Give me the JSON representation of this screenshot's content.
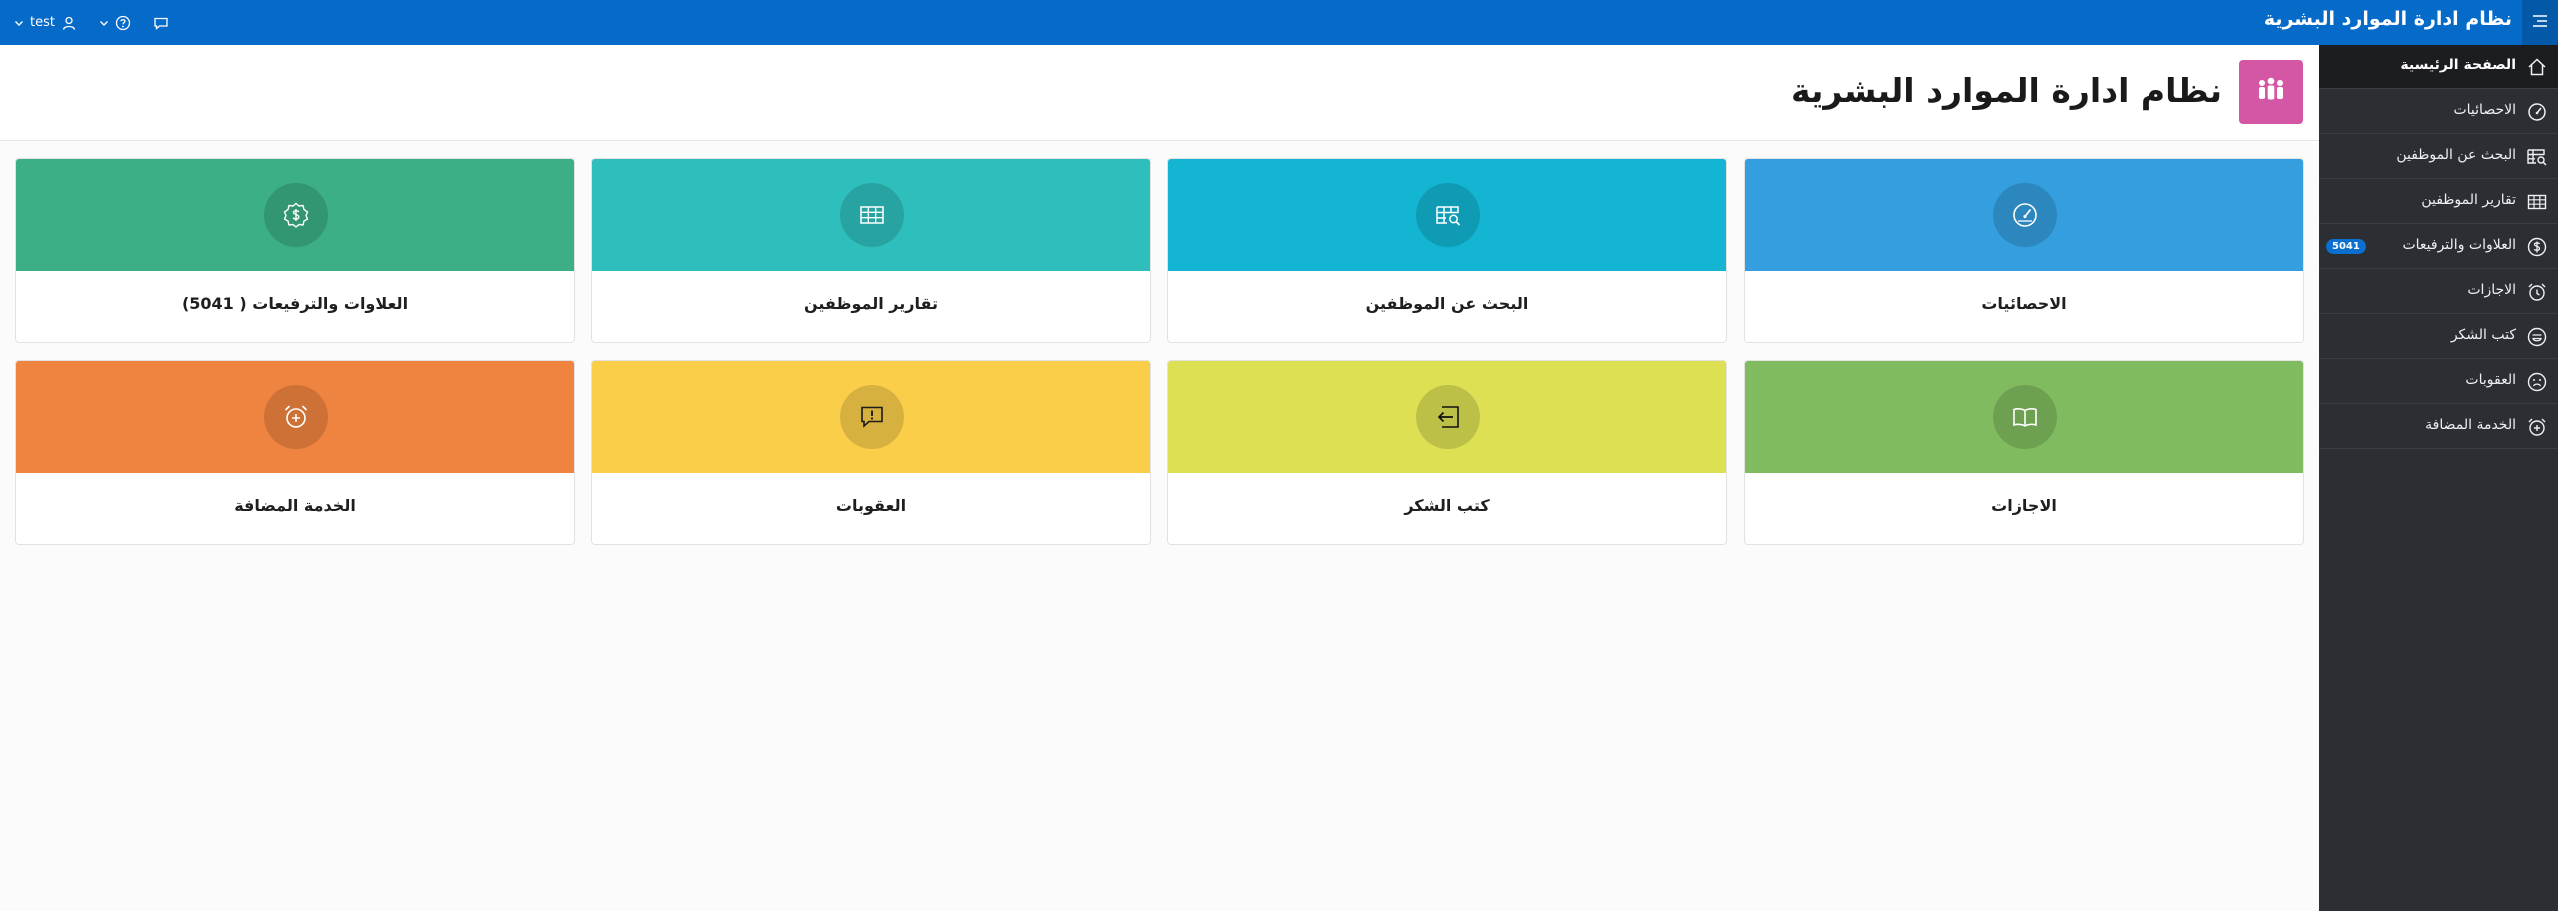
{
  "app": {
    "title": "نظام ادارة الموارد البشرية"
  },
  "topnav": {
    "user": "test"
  },
  "page": {
    "title": "نظام ادارة الموارد البشرية"
  },
  "sidebar": {
    "items": [
      {
        "label": "الصفحة الرئيسية",
        "icon": "home-icon"
      },
      {
        "label": "الاحصائيات",
        "icon": "gauge-icon"
      },
      {
        "label": "البحث عن الموظفين",
        "icon": "table-search-icon"
      },
      {
        "label": "تقارير الموظفين",
        "icon": "table-icon"
      },
      {
        "label": "العلاوات والترفيعات",
        "icon": "dollar-icon",
        "badge": "5041"
      },
      {
        "label": "الاجازات",
        "icon": "alarm-icon"
      },
      {
        "label": "كتب الشكر",
        "icon": "smile-icon"
      },
      {
        "label": "العقوبات",
        "icon": "sad-icon"
      },
      {
        "label": "الخدمة المضافة",
        "icon": "alarm-plus-icon"
      }
    ]
  },
  "cards": [
    {
      "label": "الاحصائيات",
      "color": "#349ede",
      "icon": "gauge-icon"
    },
    {
      "label": "البحث عن الموظفين",
      "color": "#13b5d2",
      "icon": "table-search-icon"
    },
    {
      "label": "تقارير الموظفين",
      "color": "#2ebfbc",
      "icon": "table-icon"
    },
    {
      "label": "العلاوات والترفيعات ( 5041)",
      "color": "#3caf85",
      "icon": "dollar-badge-icon"
    },
    {
      "label": "الاجازات",
      "color": "#81bb5f",
      "icon": "book-icon"
    },
    {
      "label": "كتب الشكر",
      "color": "#dde053",
      "icon": "exit-arrow-icon"
    },
    {
      "label": "العقوبات",
      "color": "#fbce4a",
      "icon": "alert-message-icon"
    },
    {
      "label": "الخدمة المضافة",
      "color": "#ef8440",
      "icon": "alarm-plus-icon"
    }
  ],
  "colors": {
    "topbar": "#056ac8",
    "sidebar": "#2b2e33",
    "logo": "#d357a5",
    "badge": "#0a6fcf"
  }
}
